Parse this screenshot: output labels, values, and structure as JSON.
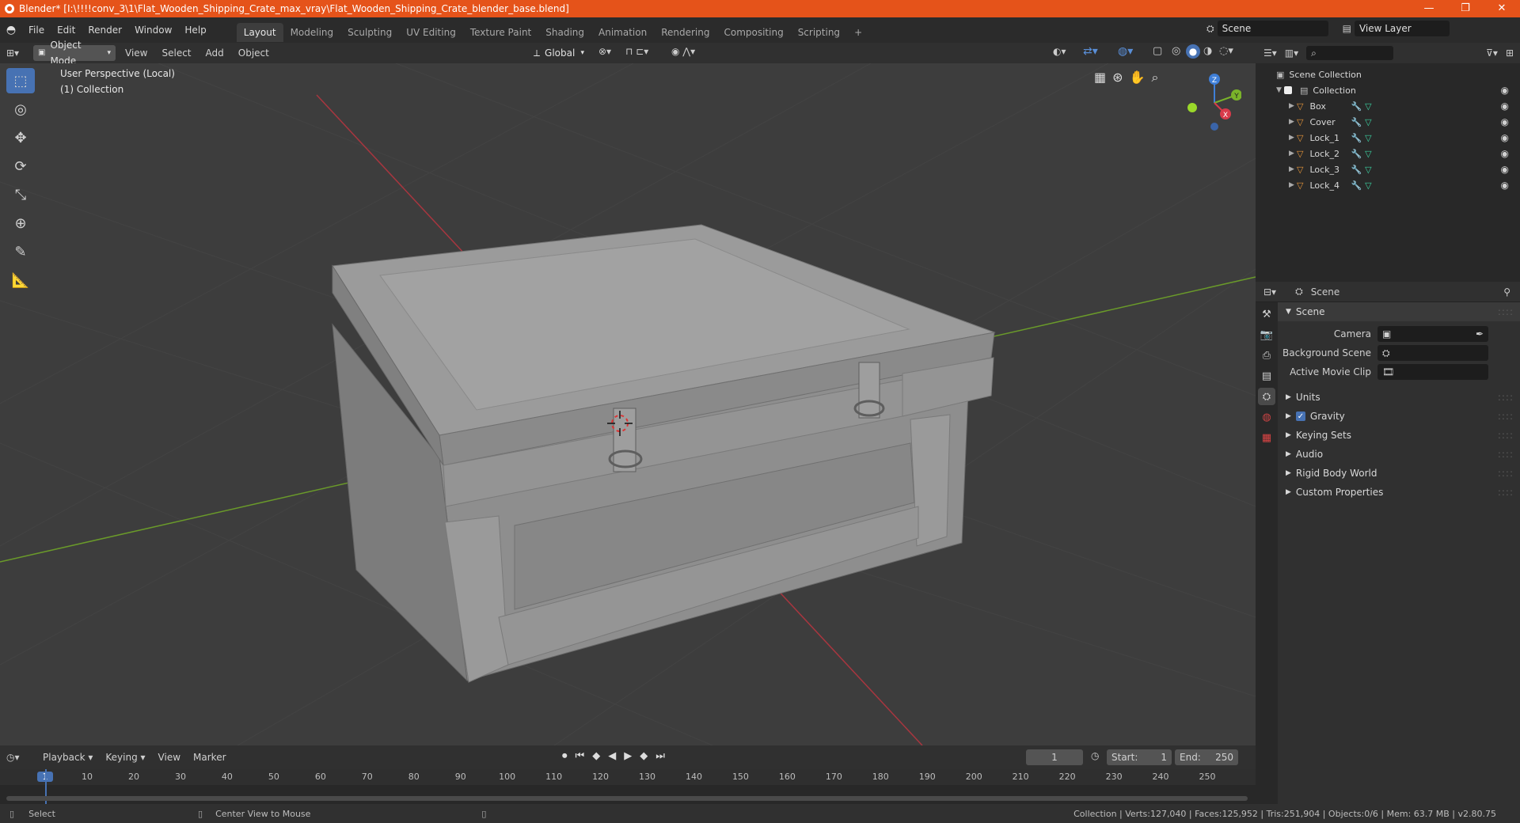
{
  "window": {
    "title": "Blender* [I:\\!!!!conv_3\\1\\Flat_Wooden_Shipping_Crate_max_vray\\Flat_Wooden_Shipping_Crate_blender_base.blend]",
    "minimize": "—",
    "maximize": "❐",
    "close": "✕"
  },
  "menu": {
    "items": [
      "File",
      "Edit",
      "Render",
      "Window",
      "Help"
    ],
    "workspaces": [
      "Layout",
      "Modeling",
      "Sculpting",
      "UV Editing",
      "Texture Paint",
      "Shading",
      "Animation",
      "Rendering",
      "Compositing",
      "Scripting"
    ],
    "add_tab": "+",
    "scene_label": "Scene",
    "view_layer_label": "View Layer"
  },
  "viewport_header": {
    "mode": "Object Mode",
    "menus": [
      "View",
      "Select",
      "Add",
      "Object"
    ],
    "transform": "Global"
  },
  "viewport": {
    "perspective": "User Perspective (Local)",
    "collection": "(1) Collection",
    "gizmo_axes": [
      "Z",
      "Y",
      "X"
    ]
  },
  "timeline": {
    "menus": [
      "Playback",
      "Keying",
      "View",
      "Marker"
    ],
    "current_frame": "1",
    "start_label": "Start:",
    "start": "1",
    "end_label": "End:",
    "end": "250",
    "ticks": [
      "1",
      "10",
      "20",
      "30",
      "40",
      "50",
      "60",
      "70",
      "80",
      "90",
      "100",
      "110",
      "120",
      "130",
      "140",
      "150",
      "160",
      "170",
      "180",
      "190",
      "200",
      "210",
      "220",
      "230",
      "240",
      "250"
    ]
  },
  "statusbar": {
    "select": "Select",
    "center_view": "Center View to Mouse",
    "stats": "Collection | Verts:127,040 | Faces:125,952 | Tris:251,904 | Objects:0/6 | Mem: 63.7 MB | v2.80.75"
  },
  "outliner": {
    "root": "Scene Collection",
    "collection": "Collection",
    "objects": [
      "Box",
      "Cover",
      "Lock_1",
      "Lock_2",
      "Lock_3",
      "Lock_4"
    ]
  },
  "properties": {
    "header": "Scene",
    "panel": "Scene",
    "camera_label": "Camera",
    "background_scene_label": "Background Scene",
    "active_clip_label": "Active Movie Clip",
    "sections": [
      "Units",
      "Gravity",
      "Keying Sets",
      "Audio",
      "Rigid Body World",
      "Custom Properties"
    ]
  }
}
